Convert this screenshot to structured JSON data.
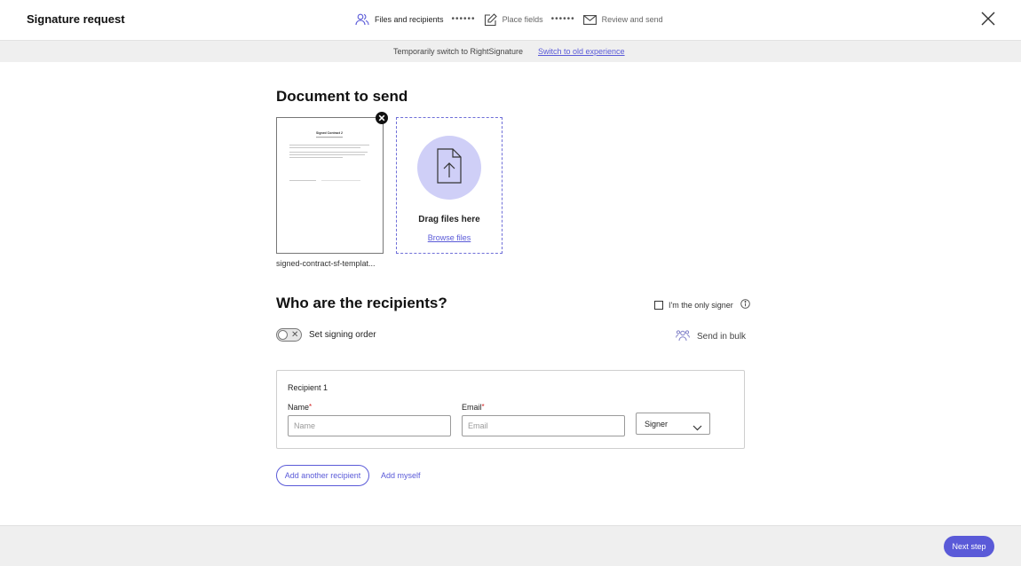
{
  "header": {
    "title": "Signature request",
    "steps": [
      {
        "label": "Files and recipients",
        "icon": "users-icon",
        "active": true
      },
      {
        "label": "Place fields",
        "icon": "edit-icon",
        "active": false
      },
      {
        "label": "Review and send",
        "icon": "envelope-icon",
        "active": false
      }
    ],
    "step_separator": "••••••"
  },
  "banner": {
    "text": "Temporarily switch to RightSignature",
    "link": "Switch to old experience"
  },
  "documents": {
    "title": "Document to send",
    "file_name": "signed-contract-sf-templat...",
    "preview_title": "Signed Contract 2",
    "drop_text": "Drag files here",
    "browse_link": "Browse files"
  },
  "recipients": {
    "title": "Who are the recipients?",
    "only_signer_label": "I'm the only signer",
    "signing_order_label": "Set signing order",
    "signing_order_enabled": false,
    "bulk_label": "Send in bulk",
    "cards": [
      {
        "heading": "Recipient 1",
        "name_label": "Name",
        "name_placeholder": "Name",
        "name_value": "",
        "email_label": "Email",
        "email_placeholder": "Email",
        "email_value": "",
        "role": "Signer"
      }
    ],
    "add_recipient_label": "Add another recipient",
    "add_myself_label": "Add myself"
  },
  "footer": {
    "next_label": "Next step"
  },
  "colors": {
    "accent": "#5a5ad8",
    "accent_light": "#cfcff7",
    "required": "#d02020",
    "banner_bg": "#efefef"
  }
}
